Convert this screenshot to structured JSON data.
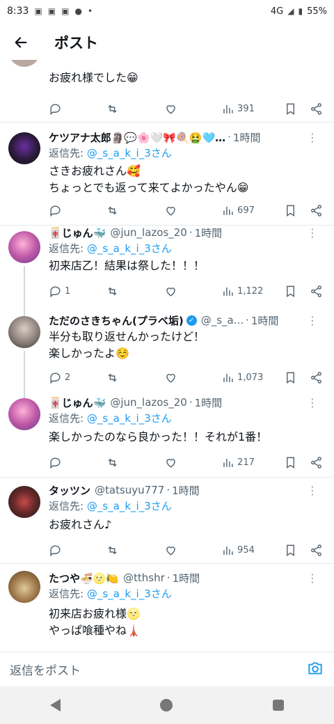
{
  "status_bar": {
    "time": "8:33",
    "network": "4G",
    "battery": "55%"
  },
  "header": {
    "title": "ポスト"
  },
  "posts": [
    {
      "body": [
        "お疲れ様でした😁"
      ],
      "stats": {
        "replies": "",
        "retweets": "",
        "likes": "",
        "views": "391"
      }
    },
    {
      "name": "ケツアナ太郎🗿💬🌸🤍🎀🍭🤮🩵…",
      "handle": "",
      "time": "1時間",
      "reply_prefix": "返信先:",
      "reply_to": "@_s_a_k_i_3さん",
      "body": [
        "さきお疲れさん🥰",
        "ちょっとでも返って来てよかったやん😁"
      ],
      "stats": {
        "replies": "",
        "retweets": "",
        "likes": "",
        "views": "697"
      }
    },
    {
      "name": "🀄じゅん🐳",
      "handle": "@jun_lazos_20",
      "time": "1時間",
      "reply_prefix": "返信先:",
      "reply_to": "@_s_a_k_i_3さん",
      "body": [
        "初来店乙！結果は祭した！！！"
      ],
      "stats": {
        "replies": "1",
        "retweets": "",
        "likes": "",
        "views": "1,122"
      }
    },
    {
      "name": "ただのさきちゃん(プラベ垢)",
      "handle": "@_s_a...",
      "time": "1時間",
      "body": [
        "半分も取り返せんかったけど！",
        "楽しかったよ☺️"
      ],
      "stats": {
        "replies": "2",
        "retweets": "",
        "likes": "",
        "views": "1,073"
      }
    },
    {
      "name": "🀄じゅん🐳",
      "handle": "@jun_lazos_20",
      "time": "1時間",
      "reply_prefix": "返信先:",
      "reply_to": "@_s_a_k_i_3さん",
      "body": [
        "楽しかったのなら良かった！！それが1番！"
      ],
      "stats": {
        "replies": "",
        "retweets": "",
        "likes": "",
        "views": "217"
      }
    },
    {
      "name": "タッツン",
      "handle": "@tatsuyu777",
      "time": "1時間",
      "reply_prefix": "返信先:",
      "reply_to": "@_s_a_k_i_3さん",
      "body": [
        "お疲れさん♪"
      ],
      "stats": {
        "replies": "",
        "retweets": "",
        "likes": "",
        "views": "954"
      }
    },
    {
      "name": "たつや🍜🌝🍋",
      "handle": "@tthshr",
      "time": "1時間",
      "reply_prefix": "返信先:",
      "reply_to": "@_s_a_k_i_3さん",
      "body": [
        "初来店お疲れ様🌝",
        "やっぱ喰種やね🗼"
      ]
    }
  ],
  "reply_bar": {
    "placeholder": "返信をポスト"
  },
  "colors": {
    "accent": "#1d9bf0",
    "text": "#0f1419",
    "muted": "#536471"
  }
}
